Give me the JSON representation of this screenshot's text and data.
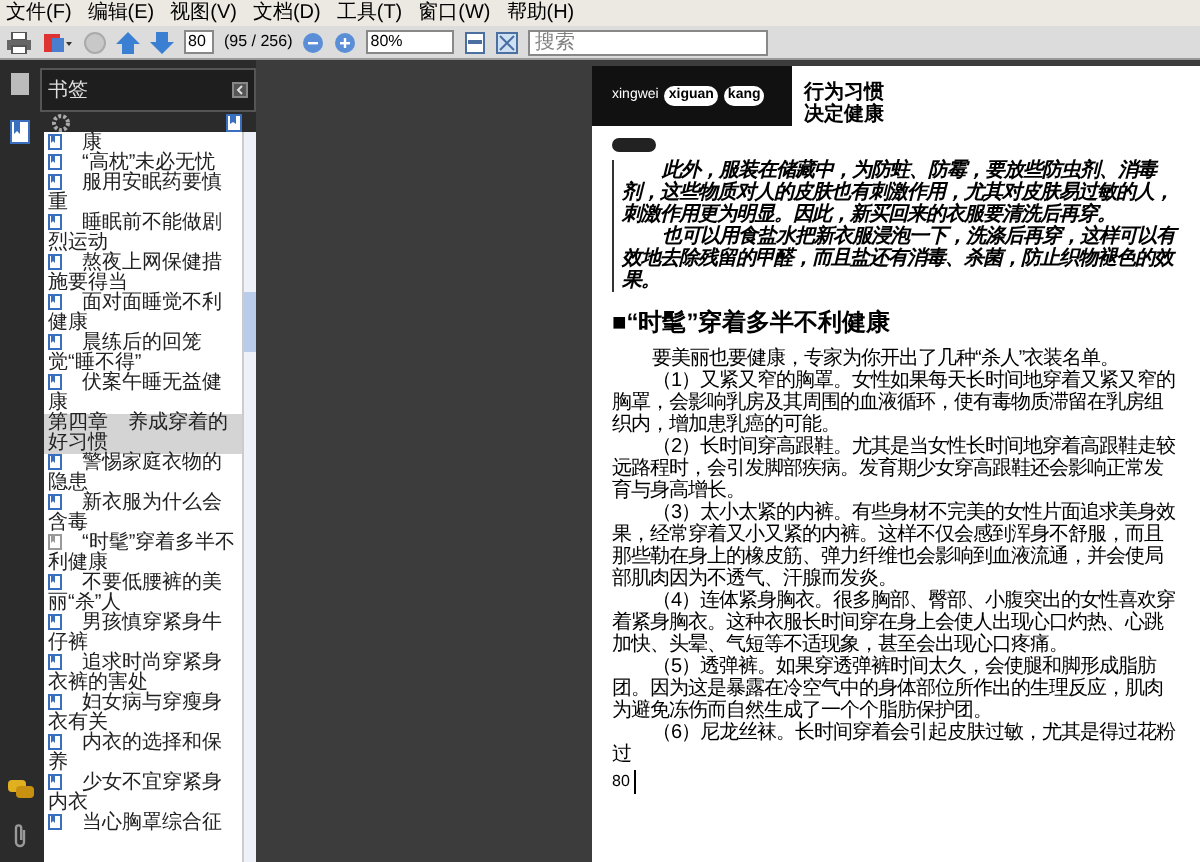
{
  "menu": [
    "文件(F)",
    "编辑(E)",
    "视图(V)",
    "文档(D)",
    "工具(T)",
    "窗口(W)",
    "帮助(H)"
  ],
  "toolbar": {
    "page_number": "80",
    "page_count": "(95 / 256)",
    "zoom": "80%",
    "search": {
      "placeholder": "搜索"
    }
  },
  "bookmarks_panel": {
    "title": "书签",
    "items": [
      {
        "label": "康",
        "kind": "section",
        "current": false,
        "selected": false
      },
      {
        "label": "“高枕”未必无忧",
        "kind": "section",
        "current": false,
        "selected": false
      },
      {
        "label": "服用安眠药要慎重",
        "kind": "section",
        "current": false,
        "selected": false
      },
      {
        "label": "睡眠前不能做剧烈运动",
        "kind": "section",
        "current": false,
        "selected": false
      },
      {
        "label": "熬夜上网保健措施要得当",
        "kind": "section",
        "current": false,
        "selected": false
      },
      {
        "label": "面对面睡觉不利健康",
        "kind": "section",
        "current": false,
        "selected": false
      },
      {
        "label": "晨练后的回笼觉“睡不得”",
        "kind": "section",
        "current": false,
        "selected": false
      },
      {
        "label": "伏案午睡无益健康",
        "kind": "section",
        "current": false,
        "selected": false
      },
      {
        "label": "第四章　养成穿着的好习惯",
        "kind": "chapter",
        "selected": true,
        "children": [
          {
            "label": "警惕家庭衣物的隐患",
            "kind": "section",
            "current": false,
            "selected": false
          },
          {
            "label": "新衣服为什么会含毒",
            "kind": "section",
            "current": false,
            "selected": false
          },
          {
            "label": "“时髦”穿着多半不利健康",
            "kind": "section",
            "current": true,
            "selected": false
          },
          {
            "label": "不要低腰裤的美丽“杀”人",
            "kind": "section",
            "current": false,
            "selected": false
          },
          {
            "label": "男孩慎穿紧身牛仔裤",
            "kind": "section",
            "current": false,
            "selected": false
          },
          {
            "label": "追求时尚穿紧身衣裤的害处",
            "kind": "section",
            "current": false,
            "selected": false
          },
          {
            "label": "妇女病与穿瘦身衣有关",
            "kind": "section",
            "current": false,
            "selected": false
          },
          {
            "label": "内衣的选择和保养",
            "kind": "section",
            "current": false,
            "selected": false
          },
          {
            "label": "少女不宜穿紧身内衣",
            "kind": "section",
            "current": false,
            "selected": false
          },
          {
            "label": "当心胸罩综合征",
            "kind": "section",
            "current": false,
            "selected": false
          }
        ]
      }
    ]
  },
  "page": {
    "header": {
      "pinyin": [
        "xingwei",
        "xiguan",
        "kang"
      ],
      "title_lines": [
        "行为习惯",
        "决定健康"
      ]
    },
    "note_paragraphs": [
      "此外，服装在储藏中，为防蛀、防霉，要放些防虫剂、消毒剂，这些物质对人的皮肤也有刺激作用，尤其对皮肤易过敏的人，刺激作用更为明显。因此，新买回来的衣服要清洗后再穿。",
      "也可以用食盐水把新衣服浸泡一下，洗涤后再穿，这样可以有效地去除残留的甲醛，而且盐还有消毒、杀菌，防止织物褪色的效果。"
    ],
    "heading": "■“时髦”穿着多半不利健康",
    "paragraphs": [
      "要美丽也要健康，专家为你开出了几种“杀人”衣装名单。",
      "（1）又紧又窄的胸罩。女性如果每天长时间地穿着又紧又窄的胸罩，会影响乳房及其周围的血液循环，使有毒物质滞留在乳房组织内，增加患乳癌的可能。",
      "（2）长时间穿高跟鞋。尤其是当女性长时间地穿着高跟鞋走较远路程时，会引发脚部疾病。发育期少女穿高跟鞋还会影响正常发育与身高增长。",
      "（3）太小太紧的内裤。有些身材不完美的女性片面追求美身效果，经常穿着又小又紧的内裤。这样不仅会感到浑身不舒服，而且那些勒在身上的橡皮筋、弹力纤维也会影响到血液流通，并会使局部肌肉因为不透气、汗腺而发炎。",
      "（4）连体紧身胸衣。很多胸部、臀部、小腹突出的女性喜欢穿着紧身胸衣。这种衣服长时间穿在身上会使人出现心口灼热、心跳加快、头晕、气短等不适现象，甚至会出现心口疼痛。",
      "（5）透弹裤。如果穿透弹裤时间太久，会使腿和脚形成脂肪团。因为这是暴露在冷空气中的身体部位所作出的生理反应，肌肉为避免冻伤而自然生成了一个个脂肪保护团。",
      "（6）尼龙丝袜。长时间穿着会引起皮肤过敏，尤其是得过花粉过"
    ],
    "page_number": "80"
  }
}
